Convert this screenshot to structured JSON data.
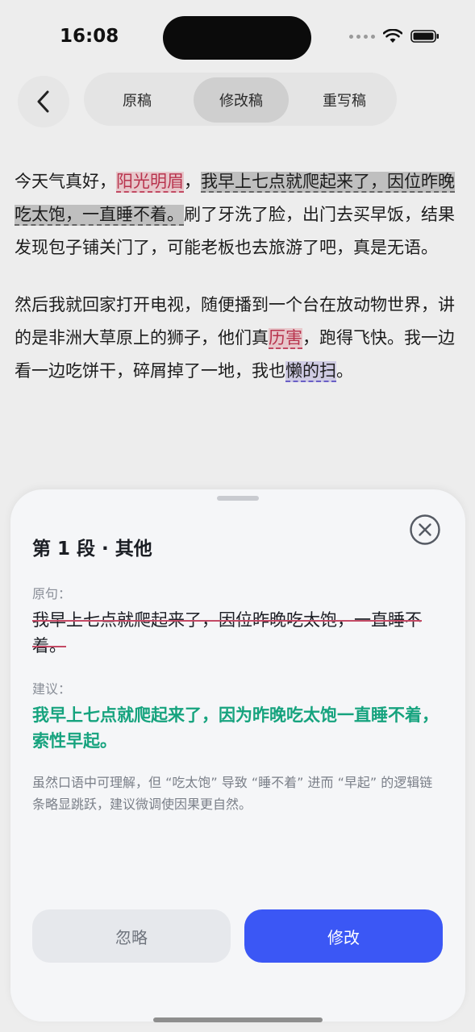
{
  "status_bar": {
    "time": "16:08"
  },
  "nav": {
    "tabs": [
      {
        "label": "原稿"
      },
      {
        "label": "修改稿"
      },
      {
        "label": "重写稿"
      }
    ],
    "active_tab": "修改稿"
  },
  "article": {
    "p1": {
      "a": "今天气真好，",
      "b": "阳光明眉",
      "c": "，",
      "d": "我早上七点就爬起来了，因位昨晚吃太饱，一直睡不着。",
      "e": "刷了牙洗了脸，出门去买早饭，结果发现包子铺关门了，可能老板也去旅游了吧，真是无语。"
    },
    "p2": {
      "a": "然后我就回家打开电视，随便播到一个台在放动物世界，讲的是非洲大草原上的狮子，他们真",
      "b": "历害",
      "c": "，跑得飞快。我一边看一边吃饼干，碎屑掉了一地，我也",
      "d": "懒的扫",
      "e": "。"
    }
  },
  "sheet": {
    "title": "第 1 段 · 其他",
    "original_label": "原句：",
    "original_text": "我早上七点就爬起来了，因位昨晚吃太饱，一直睡不着。",
    "suggestion_label": "建议：",
    "suggestion_text": "我早上七点就爬起来了，因为昨晚吃太饱一直睡不着，索性早起。",
    "description": "虽然口语中可理解，但 “吃太饱” 导致 “睡不着” 进而 “早起” 的逻辑链条略显跳跃，建议微调使因果更自然。",
    "ignore_label": "忽略",
    "apply_label": "修改"
  },
  "colors": {
    "accent": "#3b57f5",
    "suggestion": "#16a37e",
    "error_highlight": "#e7c7cb",
    "style_highlight": "#cfcbe3"
  }
}
